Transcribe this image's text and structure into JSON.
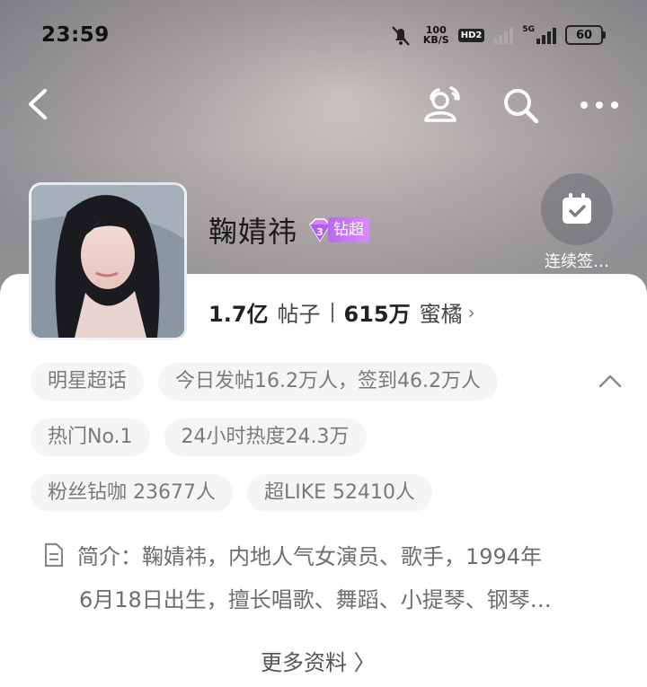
{
  "status_bar": {
    "time": "23:59",
    "net_speed_value": "100",
    "net_speed_unit": "KB/S",
    "hd_label": "HD2",
    "network_type": "5G",
    "battery": "60"
  },
  "nav": {
    "back_icon": "chevron-left-icon",
    "people_icon": "user-group-icon",
    "search_icon": "search-icon",
    "more_icon": "more-horizontal-icon"
  },
  "profile": {
    "name": "鞠婧祎",
    "badge_level": "3",
    "badge_label": "钻超"
  },
  "checkin": {
    "label": "连续签…"
  },
  "stats": {
    "posts_value": "1.7亿",
    "posts_label": "帖子",
    "fans_value": "615万",
    "fans_label": "蜜橘"
  },
  "chips": [
    [
      "明星超话",
      "今日发帖16.2万人，签到46.2万人"
    ],
    [
      "热门No.1",
      "24小时热度24.3万"
    ],
    [
      "粉丝钻咖 23677人",
      "超LIKE 52410人"
    ]
  ],
  "intro": {
    "line1": "简介：鞠婧祎，内地人气女演员、歌手，1994年",
    "line2": "6月18日出生，擅长唱歌、舞蹈、小提琴、钢琴…"
  },
  "more_link": "更多资料 〉",
  "colors": {
    "badge_purple": "#c27af5",
    "chip_bg": "#f5f5f5",
    "chip_text": "#7a7a7a"
  }
}
